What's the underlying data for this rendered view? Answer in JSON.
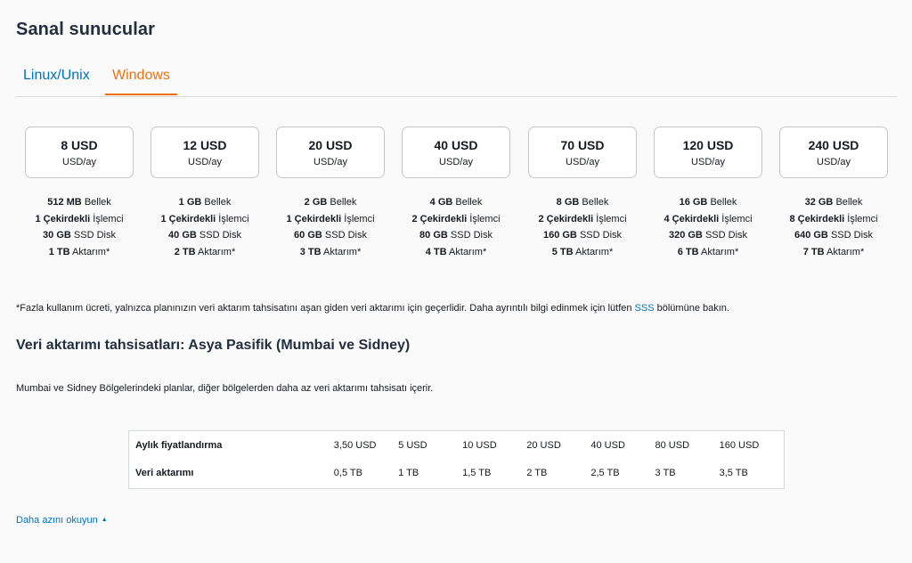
{
  "page_title": "Sanal sunucular",
  "tabs": [
    {
      "label": "Linux/Unix",
      "active": false
    },
    {
      "label": "Windows",
      "active": true
    }
  ],
  "plans": [
    {
      "price": "8 USD",
      "unit": "USD/ay",
      "memory_val": "512 MB",
      "memory_lbl": "Bellek",
      "cpu_val": "1 Çekirdekli",
      "cpu_lbl": "İşlemci",
      "disk_val": "30 GB",
      "disk_lbl": "SSD Disk",
      "transfer_val": "1 TB",
      "transfer_lbl": "Aktarım*"
    },
    {
      "price": "12 USD",
      "unit": "USD/ay",
      "memory_val": "1 GB",
      "memory_lbl": "Bellek",
      "cpu_val": "1 Çekirdekli",
      "cpu_lbl": "İşlemci",
      "disk_val": "40 GB",
      "disk_lbl": "SSD Disk",
      "transfer_val": "2 TB",
      "transfer_lbl": "Aktarım*"
    },
    {
      "price": "20 USD",
      "unit": "USD/ay",
      "memory_val": "2 GB",
      "memory_lbl": "Bellek",
      "cpu_val": "1 Çekirdekli",
      "cpu_lbl": "İşlemci",
      "disk_val": "60 GB",
      "disk_lbl": "SSD Disk",
      "transfer_val": "3 TB",
      "transfer_lbl": "Aktarım*"
    },
    {
      "price": "40 USD",
      "unit": "USD/ay",
      "memory_val": "4 GB",
      "memory_lbl": "Bellek",
      "cpu_val": "2 Çekirdekli",
      "cpu_lbl": "İşlemci",
      "disk_val": "80 GB",
      "disk_lbl": "SSD Disk",
      "transfer_val": "4 TB",
      "transfer_lbl": "Aktarım*"
    },
    {
      "price": "70 USD",
      "unit": "USD/ay",
      "memory_val": "8 GB",
      "memory_lbl": "Bellek",
      "cpu_val": "2 Çekirdekli",
      "cpu_lbl": "İşlemci",
      "disk_val": "160 GB",
      "disk_lbl": "SSD Disk",
      "transfer_val": "5 TB",
      "transfer_lbl": "Aktarım*"
    },
    {
      "price": "120 USD",
      "unit": "USD/ay",
      "memory_val": "16 GB",
      "memory_lbl": "Bellek",
      "cpu_val": "4 Çekirdekli",
      "cpu_lbl": "İşlemci",
      "disk_val": "320 GB",
      "disk_lbl": "SSD Disk",
      "transfer_val": "6 TB",
      "transfer_lbl": "Aktarım*"
    },
    {
      "price": "240 USD",
      "unit": "USD/ay",
      "memory_val": "32 GB",
      "memory_lbl": "Bellek",
      "cpu_val": "8 Çekirdekli",
      "cpu_lbl": "İşlemci",
      "disk_val": "640 GB",
      "disk_lbl": "SSD Disk",
      "transfer_val": "7 TB",
      "transfer_lbl": "Aktarım*"
    }
  ],
  "footnote": {
    "text": "*Fazla kullanım ücreti, yalnızca planınızın veri aktarım tahsisatını aşan giden veri aktarımı için geçerlidir. Daha ayrıntılı bilgi edinmek için lütfen ",
    "link": "SSS",
    "suffix": " bölümüne bakın."
  },
  "section": {
    "title": "Veri aktarımı tahsisatları: Asya Pasifik (Mumbai ve Sidney)",
    "description": "Mumbai ve Sidney Bölgelerindeki planlar, diğer bölgelerden daha az veri aktarımı tahsisatı içerir."
  },
  "table": {
    "rows": [
      {
        "label": "Aylık fiyatlandırma",
        "values": [
          "3,50 USD",
          "5 USD",
          "10 USD",
          "20 USD",
          "40 USD",
          "80 USD",
          "160 USD"
        ]
      },
      {
        "label": "Veri aktarımı",
        "values": [
          "0,5 TB",
          "1 TB",
          "1,5 TB",
          "2 TB",
          "2,5 TB",
          "3 TB",
          "3,5 TB"
        ]
      }
    ]
  },
  "read_less": {
    "label": "Daha azını okuyun",
    "caret": "▲"
  },
  "colors": {
    "accent": "#ec7211",
    "link": "#0073bb",
    "heading": "#232f3e"
  }
}
